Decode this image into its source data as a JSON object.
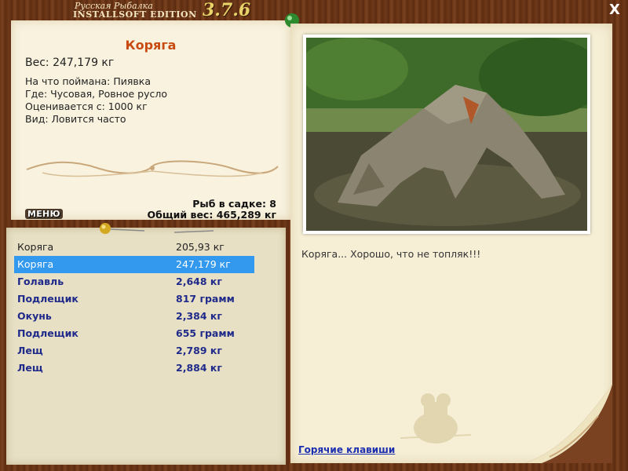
{
  "app": {
    "brand_line1": "Русская Рыбалка",
    "brand_line2": "INSTALLSOFT EDITION",
    "version": "3.7.6",
    "close_label": "X"
  },
  "catch": {
    "name": "Коряга",
    "weight": "Вес: 247,179 кг",
    "details": [
      "На что поймана: Пиявка",
      "Где: Чусовая, Ровное русло",
      "Оценивается с: 1000 кг",
      "Вид: Ловится часто"
    ]
  },
  "menu_label": "МЕНЮ",
  "cage": {
    "count": "Рыб в садке: 8",
    "total": "Общий вес: 465,289 кг"
  },
  "fish_list": [
    {
      "name": "Коряга",
      "weight": "205,93 кг",
      "style": "plain"
    },
    {
      "name": "Коряга",
      "weight": "247,179 кг",
      "style": "selected"
    },
    {
      "name": "Голавль",
      "weight": "2,648 кг",
      "style": "bold"
    },
    {
      "name": "Подлещик",
      "weight": "817 грамм",
      "style": "bold"
    },
    {
      "name": "Окунь",
      "weight": "2,384 кг",
      "style": "bold"
    },
    {
      "name": "Подлещик",
      "weight": "655 грамм",
      "style": "bold"
    },
    {
      "name": "Лещ",
      "weight": "2,789 кг",
      "style": "bold"
    },
    {
      "name": "Лещ",
      "weight": "2,884 кг",
      "style": "bold"
    }
  ],
  "caption": "Коряга... Хорошо, что не топляк!!!",
  "hotkeys_label": "Горячие клавиши",
  "colors": {
    "title_accent": "#c84a10",
    "selected_row": "#3399ee",
    "fish_bold": "#1f2a8a",
    "link": "#1c2fb0"
  }
}
